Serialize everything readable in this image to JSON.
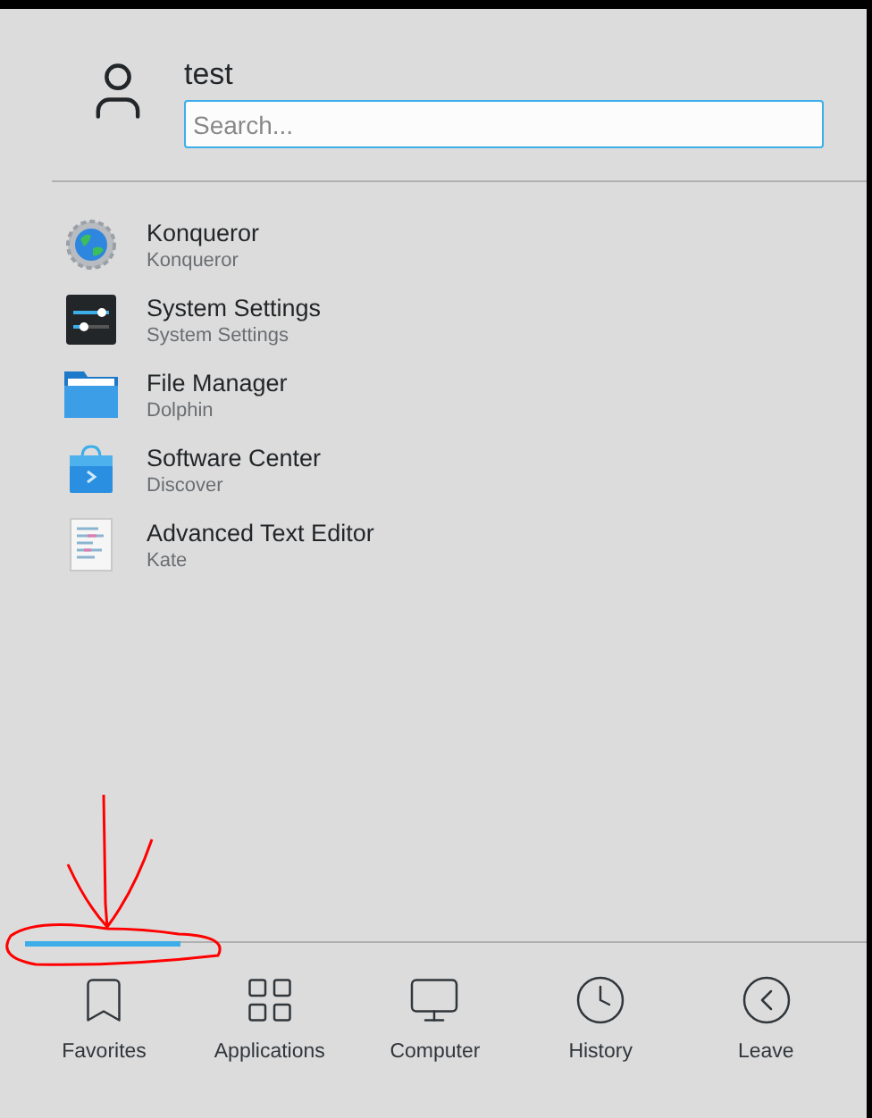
{
  "user": {
    "name": "test"
  },
  "search": {
    "placeholder": "Search..."
  },
  "favorites": [
    {
      "kind": "browser",
      "name": "Konqueror",
      "subtitle": "Konqueror"
    },
    {
      "kind": "settings",
      "name": "System Settings",
      "subtitle": "System Settings"
    },
    {
      "kind": "folder",
      "name": "File Manager",
      "subtitle": "Dolphin"
    },
    {
      "kind": "store",
      "name": "Software Center",
      "subtitle": "Discover"
    },
    {
      "kind": "editor",
      "name": "Advanced Text Editor",
      "subtitle": "Kate"
    }
  ],
  "tabs": [
    {
      "kind": "favorites",
      "label": "Favorites",
      "selected": true
    },
    {
      "kind": "applications",
      "label": "Applications",
      "selected": false
    },
    {
      "kind": "computer",
      "label": "Computer",
      "selected": false
    },
    {
      "kind": "history",
      "label": "History",
      "selected": false
    },
    {
      "kind": "leave",
      "label": "Leave",
      "selected": false
    }
  ]
}
